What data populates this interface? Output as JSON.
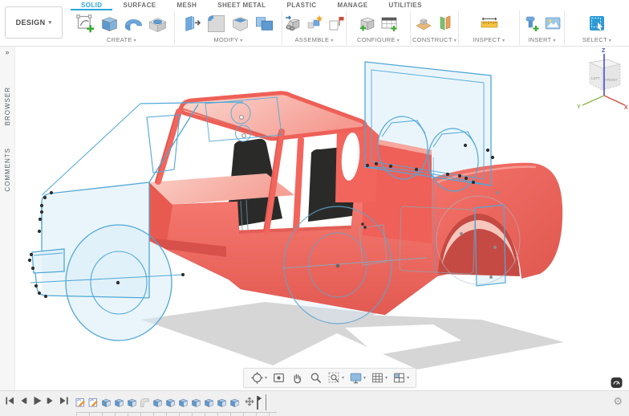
{
  "app": {
    "design_label": "DESIGN",
    "tabs": [
      {
        "label": "SOLID",
        "active": true
      },
      {
        "label": "SURFACE",
        "active": false
      },
      {
        "label": "MESH",
        "active": false
      },
      {
        "label": "SHEET METAL",
        "active": false
      },
      {
        "label": "PLASTIC",
        "active": false
      },
      {
        "label": "MANAGE",
        "active": false
      },
      {
        "label": "UTILITIES",
        "active": false
      }
    ],
    "toolbar_groups": [
      {
        "label": "CREATE",
        "tools": [
          {
            "name": "create-sketch",
            "icon": "sketch"
          },
          {
            "name": "extrude",
            "icon": "extrude"
          },
          {
            "name": "revolve",
            "icon": "revolve"
          },
          {
            "name": "hole",
            "icon": "hole"
          }
        ]
      },
      {
        "label": "MODIFY",
        "tools": [
          {
            "name": "press-pull",
            "icon": "presspull"
          },
          {
            "name": "fillet",
            "icon": "fillet"
          },
          {
            "name": "shell",
            "icon": "shell"
          },
          {
            "name": "combine",
            "icon": "combine"
          }
        ]
      },
      {
        "label": "ASSEMBLE",
        "tools": [
          {
            "name": "new-component",
            "icon": "newcomp"
          },
          {
            "name": "joint",
            "icon": "joint"
          },
          {
            "name": "joint-origin",
            "icon": "jointorigin"
          }
        ]
      },
      {
        "label": "CONFIGURE",
        "tools": [
          {
            "name": "configuration",
            "icon": "config"
          },
          {
            "name": "configuration-table",
            "icon": "configtable"
          }
        ]
      },
      {
        "label": "CONSTRUCT",
        "tools": [
          {
            "name": "construction-plane",
            "icon": "plane1"
          },
          {
            "name": "plane-at-angle",
            "icon": "plane2"
          }
        ]
      },
      {
        "label": "INSPECT",
        "tools": [
          {
            "name": "measure",
            "icon": "measure"
          }
        ]
      },
      {
        "label": "INSERT",
        "tools": [
          {
            "name": "insert-fastener",
            "icon": "fastener"
          },
          {
            "name": "insert-image",
            "icon": "image"
          }
        ]
      },
      {
        "label": "SELECT",
        "tools": [
          {
            "name": "select",
            "icon": "select"
          }
        ]
      }
    ]
  },
  "left_rail": {
    "expand": "»",
    "browser": "BROWSER",
    "comments": "COMMENTS"
  },
  "viewcube": {
    "axis_x": "X",
    "axis_y": "Y",
    "axis_z": "Z",
    "face_left": "LEFT",
    "face_front": "FRONT"
  },
  "nav_bar": {
    "tools": [
      {
        "name": "orbit",
        "caret": true
      },
      {
        "name": "look-at",
        "caret": false
      },
      {
        "name": "pan",
        "caret": false
      },
      {
        "name": "zoom",
        "caret": false
      },
      {
        "name": "fit",
        "caret": true
      },
      {
        "name": "display-settings",
        "caret": true
      },
      {
        "name": "grid-settings",
        "caret": true
      },
      {
        "name": "viewports",
        "caret": true
      }
    ]
  },
  "timeline": {
    "playback": [
      "go-to-start",
      "step-back",
      "play",
      "step-forward",
      "go-to-end"
    ],
    "features": [
      "sketch",
      "sketch",
      "extrude",
      "extrude",
      "extrude",
      "fillet",
      "extrude",
      "extrude",
      "extrude",
      "extrude",
      "extrude",
      "extrude",
      "extrude"
    ],
    "marker_name": "timeline-position-marker",
    "settings_icon": "gear"
  },
  "colors": {
    "accent_blue": "#29a7de",
    "body_red": "#f2655c",
    "body_dark": "#dc544c",
    "body_pink": "#f8bcb3",
    "sketch_blue": "#4fa8d8",
    "sketch_plane": "#d9ecf8",
    "shadow_gray": "#d6d6d6",
    "seat_black": "#2a2b29"
  }
}
